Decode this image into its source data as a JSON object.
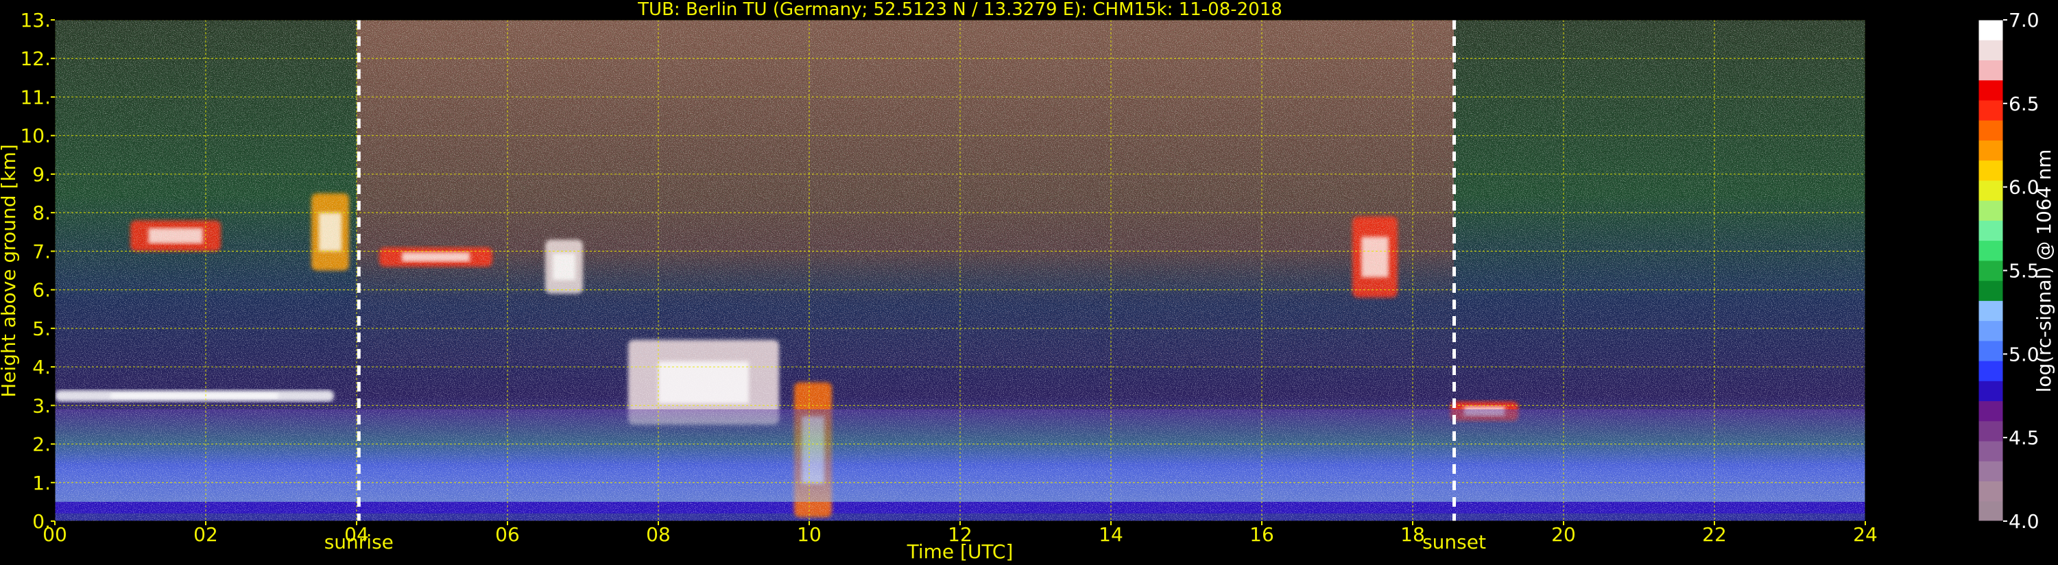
{
  "chart_data": {
    "type": "heatmap",
    "title": "TUB: Berlin TU (Germany; 52.5123 N / 13.3279 E):    CHM15k: 11-08-2018",
    "xlabel": "Time [UTC]",
    "ylabel": "Height above ground [km]",
    "xlim": [
      0,
      24
    ],
    "ylim": [
      0,
      13
    ],
    "x_ticks": [
      0,
      2,
      4,
      6,
      8,
      10,
      12,
      14,
      16,
      18,
      20,
      22,
      24
    ],
    "x_tick_labels": [
      "00",
      "02",
      "04",
      "06",
      "08",
      "10",
      "12",
      "14",
      "16",
      "18",
      "20",
      "22",
      "24"
    ],
    "y_ticks": [
      0,
      1,
      2,
      3,
      4,
      5,
      6,
      7,
      8,
      9,
      10,
      11,
      12,
      13
    ],
    "y_tick_labels": [
      "0.",
      "1.",
      "2.",
      "3.",
      "4.",
      "5.",
      "6.",
      "7.",
      "8.",
      "9.",
      "10.",
      "11.",
      "12.",
      "13."
    ],
    "grid": true,
    "events": [
      {
        "label": "sunrise",
        "time": 4.03
      },
      {
        "label": "sunset",
        "time": 18.55
      }
    ],
    "colorbar": {
      "label": "log(rc-signal) @ 1064 nm",
      "range": [
        4.0,
        7.0
      ],
      "ticks": [
        4.0,
        4.5,
        5.0,
        5.5,
        6.0,
        6.5,
        7.0
      ],
      "tick_labels": [
        "4.0",
        "4.5",
        "5.0",
        "5.5",
        "6.0",
        "6.5",
        "7.0"
      ],
      "colors": [
        "#a08898",
        "#a8899c",
        "#9c78a0",
        "#8c5c98",
        "#7a3a8c",
        "#6a1a8c",
        "#2a10c0",
        "#2b3bff",
        "#4a78ff",
        "#6ea0ff",
        "#8ec0ff",
        "#0a8a2a",
        "#20b040",
        "#3ce070",
        "#70f0a0",
        "#a8f070",
        "#e8f020",
        "#ffd000",
        "#ff9a00",
        "#ff6a00",
        "#ff2a10",
        "#f00000",
        "#f4b8bc",
        "#f0dede",
        "#ffffff"
      ]
    },
    "features": [
      {
        "type": "boundary_layer",
        "time": [
          0,
          24
        ],
        "height_km": [
          0.2,
          0.5
        ],
        "log_signal": 4.8
      },
      {
        "type": "cloud",
        "time": [
          0,
          3.7
        ],
        "height_km": [
          3.1,
          3.4
        ],
        "log_signal": 7.0
      },
      {
        "type": "cloud",
        "time": [
          1.0,
          2.2
        ],
        "height_km": [
          7.0,
          7.8
        ],
        "log_signal": 6.5
      },
      {
        "type": "cloud",
        "time": [
          3.4,
          3.9
        ],
        "height_km": [
          6.5,
          8.5
        ],
        "log_signal": 6.2
      },
      {
        "type": "cloud",
        "time": [
          4.3,
          5.8
        ],
        "height_km": [
          6.6,
          7.1
        ],
        "log_signal": 6.5
      },
      {
        "type": "cloud",
        "time": [
          6.5,
          7.0
        ],
        "height_km": [
          5.9,
          7.3
        ],
        "log_signal": 6.8
      },
      {
        "type": "cloud",
        "time": [
          7.6,
          9.6
        ],
        "height_km": [
          2.5,
          4.7
        ],
        "log_signal": 6.8
      },
      {
        "type": "cloud",
        "time": [
          9.8,
          10.3
        ],
        "height_km": [
          0.1,
          3.6
        ],
        "log_signal": 6.3
      },
      {
        "type": "cloud",
        "time": [
          17.2,
          17.8
        ],
        "height_km": [
          5.8,
          7.9
        ],
        "log_signal": 6.4
      },
      {
        "type": "cloud",
        "time": [
          18.5,
          19.4
        ],
        "height_km": [
          2.6,
          3.1
        ],
        "log_signal": 6.5
      },
      {
        "type": "aerosol_layer",
        "time": [
          0,
          24
        ],
        "height_km": [
          0.5,
          2.9
        ],
        "log_signal": 5.3
      }
    ]
  }
}
